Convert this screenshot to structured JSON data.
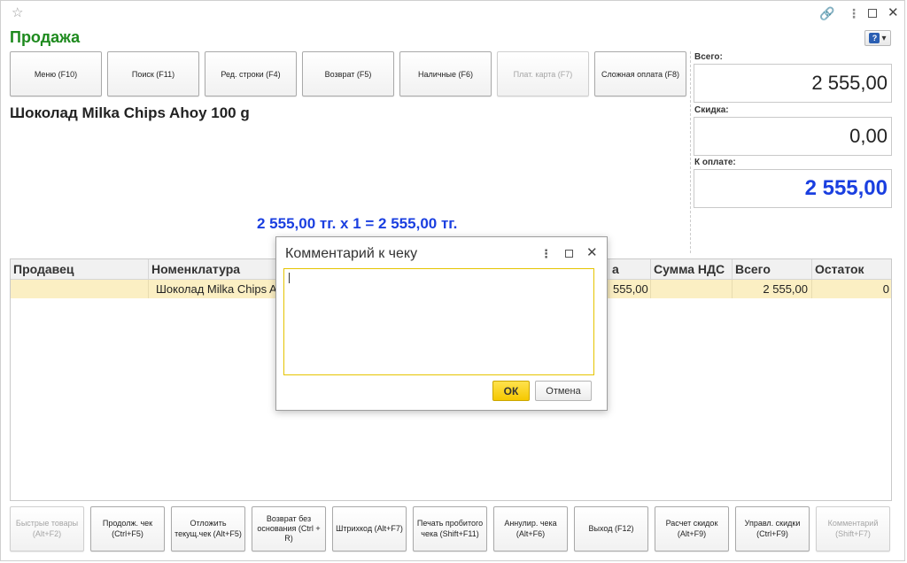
{
  "window": {
    "star_icon": "star-icon",
    "link_icon": "link-icon",
    "more_icon": "more-vertical-icon",
    "maximize_icon": "maximize-icon",
    "close_icon": "close-icon"
  },
  "title": "Продажа",
  "help_button": {
    "glyph": "?",
    "caret": "▾"
  },
  "top_buttons": [
    {
      "label": "Меню (F10)",
      "enabled": true
    },
    {
      "label": "Поиск (F11)",
      "enabled": true
    },
    {
      "label": "Ред. строки (F4)",
      "enabled": true
    },
    {
      "label": "Возврат (F5)",
      "enabled": true
    },
    {
      "label": "Наличные (F6)",
      "enabled": true
    },
    {
      "label": "Плат. карта (F7)",
      "enabled": false
    },
    {
      "label": "Сложная оплата (F8)",
      "enabled": true
    }
  ],
  "product": {
    "name": "Шоколад Milka Chips Ahoy 100 g",
    "price_line": "2 555,00 тг. х 1  = 2 555,00 тг."
  },
  "totals": {
    "total_label": "Всего:",
    "total_value": "2 555,00",
    "discount_label": "Скидка:",
    "discount_value": "0,00",
    "to_pay_label": "К оплате:",
    "to_pay_value": "2 555,00",
    "to_pay_color": "#1a3fe0"
  },
  "table": {
    "headers": [
      "Продавец",
      "Номенклатура",
      "а",
      "Сумма НДС",
      "Всего",
      "Остаток"
    ],
    "rows": [
      {
        "seller": "",
        "item": "Шоколад Milka Chips A",
        "sum": "555,00",
        "vat": "",
        "total": "2 555,00",
        "stock": "0"
      }
    ],
    "selected_row_color": "#fbefc3"
  },
  "bottom_buttons": [
    {
      "label": "Быстрые товары (Alt+F2)",
      "enabled": false
    },
    {
      "label": "Продолж. чек (Ctrl+F5)",
      "enabled": true
    },
    {
      "label": "Отложить текущ.чек (Alt+F5)",
      "enabled": true
    },
    {
      "label": "Возврат без основания (Ctrl + R)",
      "enabled": true
    },
    {
      "label": "Штрихкод (Alt+F7)",
      "enabled": true
    },
    {
      "label": "Печать пробитого чека (Shift+F11)",
      "enabled": true
    },
    {
      "label": "Аннулир. чека (Alt+F6)",
      "enabled": true
    },
    {
      "label": "Выход (F12)",
      "enabled": true
    },
    {
      "label": "Расчет скидок (Alt+F9)",
      "enabled": true
    },
    {
      "label": "Управл. скидки (Ctrl+F9)",
      "enabled": true
    },
    {
      "label": "Комментарий (Shift+F7)",
      "enabled": false
    }
  ],
  "dialog": {
    "title": "Комментарий к чеку",
    "comment_value": "",
    "ok_label": "ОК",
    "cancel_label": "Отмена",
    "accent_color": "#f5c800"
  }
}
